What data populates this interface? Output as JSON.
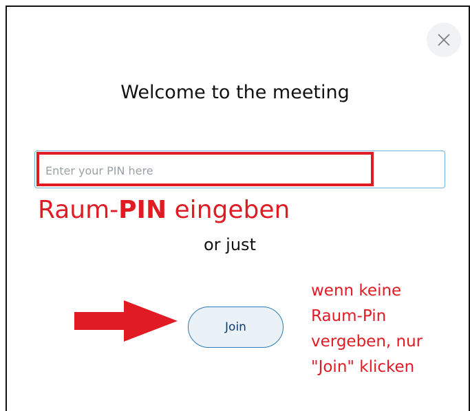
{
  "dialog": {
    "title": "Welcome to the meeting",
    "close_icon": "close-icon",
    "pin_input": {
      "placeholder": "Enter your PIN here",
      "value": ""
    },
    "or_text": "or just",
    "join_label": "Join"
  },
  "annotations": {
    "pin_hint_prefix": "Raum-",
    "pin_hint_bold": "PIN",
    "pin_hint_suffix": " eingeben",
    "side_note_lines": [
      "wenn keine",
      "Raum-Pin",
      "vergeben, nur",
      "\"Join\" klicken"
    ],
    "arrow_icon": "arrow-right-icon",
    "color": "#e01b24"
  },
  "colors": {
    "accent_border": "#6fb3d6",
    "join_border": "#2a7bb5",
    "join_bg": "#eaf1f7",
    "join_text": "#0f3b6f"
  }
}
